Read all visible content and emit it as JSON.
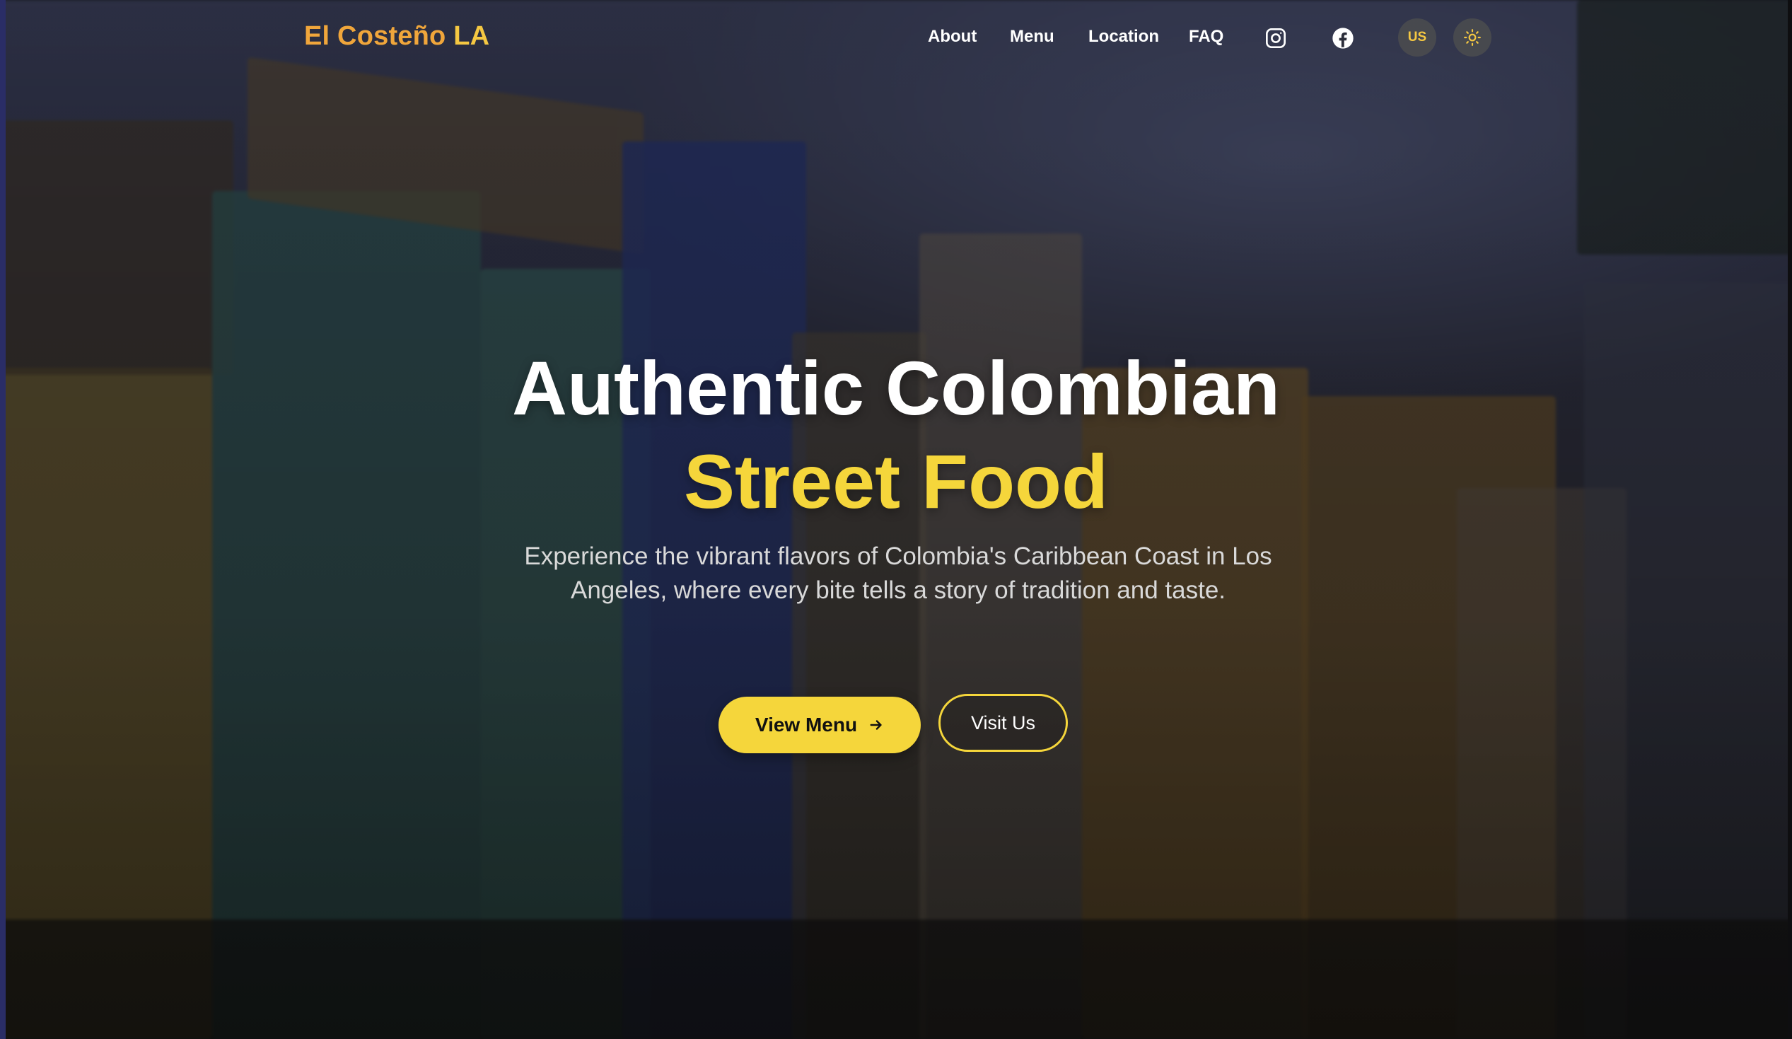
{
  "brand": {
    "part1": "El Costeño",
    "part2": "LA"
  },
  "nav": [
    {
      "label": "About"
    },
    {
      "label": "Menu"
    },
    {
      "label": "Location"
    },
    {
      "label": "FAQ"
    }
  ],
  "social": {
    "instagram_icon": "instagram-icon",
    "facebook_icon": "facebook-icon"
  },
  "language": {
    "label": "US"
  },
  "theme_toggle": {
    "icon": "sun-icon"
  },
  "hero": {
    "title_line1": "Authentic Colombian",
    "title_line2": "Street Food",
    "subtitle": "Experience the vibrant flavors of Colombia's Caribbean Coast in Los Angeles, where every bite tells a story of tradition and taste.",
    "primary_button": "View Menu",
    "secondary_button": "Visit Us"
  },
  "colors": {
    "accent_yellow": "#f5d63b",
    "brand_orange": "#f0a63b",
    "text_white": "#ffffff"
  }
}
